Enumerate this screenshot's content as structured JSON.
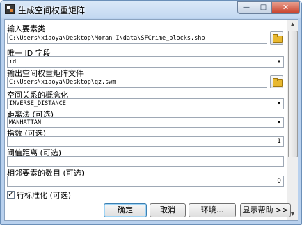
{
  "window": {
    "title": "生成空间权重矩阵",
    "minimize": "—",
    "maximize": "□",
    "close": "✕"
  },
  "fields": {
    "input_features": {
      "label": "输入要素类",
      "value": "C:\\Users\\xiaoya\\Desktop\\Moran I\\data\\SFCrime_blocks.shp"
    },
    "unique_id": {
      "label": "唯一 ID 字段",
      "value": "id"
    },
    "output_swm": {
      "label": "输出空间权重矩阵文件",
      "value": "C:\\Users\\xiaoya\\Desktop\\qz.swm"
    },
    "conceptualization": {
      "label": "空间关系的概念化",
      "value": "INVERSE_DISTANCE"
    },
    "distance_method": {
      "label": "距离法 (可选)",
      "value": "MANHATTAN"
    },
    "exponent": {
      "label": "指数 (可选)",
      "value": "1"
    },
    "threshold_distance": {
      "label": "阈值距离 (可选)",
      "value": ""
    },
    "num_neighbors": {
      "label": "相邻要素的数目 (可选)",
      "value": "0"
    },
    "row_standardization": {
      "label": "行标准化 (可选)",
      "checked": "✓"
    }
  },
  "buttons": {
    "ok": "确定",
    "cancel": "取消",
    "environments": "环境...",
    "show_help": "显示帮助 >>"
  },
  "scrollbar": {
    "up": "▲",
    "down": "▼"
  },
  "icons": {
    "window": "toolbox-icon",
    "browse": "folder-icon"
  }
}
